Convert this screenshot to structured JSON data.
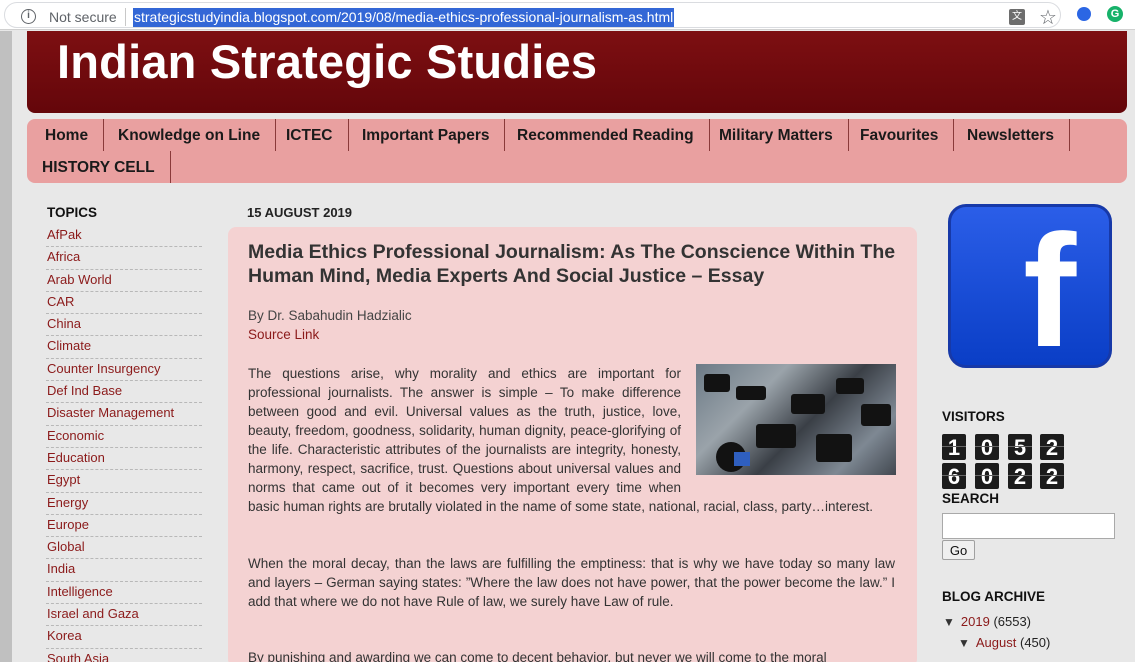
{
  "browser": {
    "security_label": "Not secure",
    "url": "strategicstudyindia.blogspot.com/2019/08/media-ethics-professional-journalism-as.html",
    "info_icon": "i",
    "translate_icon": "translate-icon",
    "star_icon": "☆",
    "ext2_icon_letter": "G"
  },
  "site": {
    "title": "Indian Strategic Studies"
  },
  "nav": {
    "items": [
      "Home",
      "Knowledge on Line",
      "ICTEC",
      "Important Papers",
      "Recommended Reading",
      "Military Matters",
      "Favourites",
      "Newsletters",
      "HISTORY CELL"
    ]
  },
  "sidebar": {
    "topics_heading": "TOPICS",
    "topics": [
      "AfPak",
      "Africa",
      "Arab World",
      "CAR",
      "China",
      "Climate",
      "Counter Insurgency",
      "Def Ind Base",
      "Disaster Management",
      "Economic",
      "Education",
      "Egypt",
      "Energy",
      "Europe",
      "Global",
      "India",
      "Intelligence",
      "Israel and Gaza",
      "Korea",
      "South Asia"
    ]
  },
  "post": {
    "date": "15 AUGUST 2019",
    "title": "Media Ethics Professional Journalism: As The Conscience Within The Human Mind, Media Experts And Social Justice – Essay",
    "byline": "By Dr. Sabahudin Hadzialic",
    "source_link": "Source Link",
    "paragraphs": [
      "The questions arise, why morality and ethics are important for professional journalists. The answer is simple – To make difference between good and evil. Universal values as the truth, justice, love, beauty, freedom, goodness, solidarity, human dignity, peace-glorifying of the life. Characteristic attributes of the journalists are integrity, honesty, harmony, respect, sacrifice, trust. Questions about universal values and norms that came out of it becomes very important every time when basic human rights are brutally violated in the name of some state, national, racial, class, party…interest.",
      "When the moral decay, than the laws are fulfilling the emptiness: that is why we have today so many law and layers – German saying states: ”Where the law does not have power, that the power become the law.” I add that where we do not have Rule of law, we surely have Law of rule.",
      "By punishing and awarding we can come to decent behavior, but never we will come to the moral"
    ]
  },
  "right": {
    "fb_icon": "facebook-icon",
    "fb_letter": "f",
    "visitors_heading": "VISITORS",
    "visitor_digits": [
      "1",
      "0",
      "5",
      "2",
      "6",
      "0",
      "2",
      "2"
    ],
    "search_heading": "SEARCH",
    "search_value": "",
    "go_label": "Go",
    "archive_heading": "BLOG ARCHIVE",
    "archive": {
      "year": "2019",
      "year_count": "(6553)",
      "month": "August",
      "month_count": "(450)"
    },
    "triangle": "▼"
  },
  "colors": {
    "header": "#6e0a0e",
    "nav": "#e9a0a0",
    "post_bg": "#f4d2d2",
    "link": "#8b1a1a"
  }
}
